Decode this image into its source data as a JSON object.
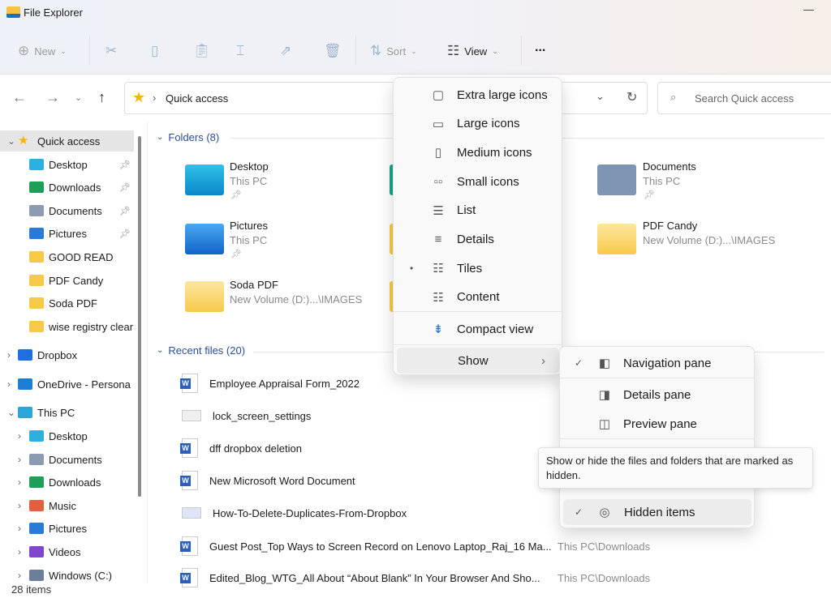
{
  "window": {
    "title": "File Explorer",
    "status": "28 items"
  },
  "toolbar": {
    "new": "New",
    "sort": "Sort",
    "view": "View",
    "more": "..."
  },
  "address": {
    "location": "Quick access",
    "search_placeholder": "Search Quick access"
  },
  "sidebar": {
    "items": [
      {
        "label": "Quick access",
        "icon": "star"
      },
      {
        "label": "Desktop",
        "icon": "desktop",
        "pinned": true
      },
      {
        "label": "Downloads",
        "icon": "download",
        "pinned": true
      },
      {
        "label": "Documents",
        "icon": "documents",
        "pinned": true
      },
      {
        "label": "Pictures",
        "icon": "pictures",
        "pinned": true
      },
      {
        "label": "GOOD READ",
        "icon": "folder"
      },
      {
        "label": "PDF Candy",
        "icon": "folder"
      },
      {
        "label": "Soda PDF",
        "icon": "folder"
      },
      {
        "label": "wise registry clear",
        "icon": "folder"
      },
      {
        "label": "Dropbox",
        "icon": "dropbox"
      },
      {
        "label": "OneDrive - Persona",
        "icon": "onedrive"
      },
      {
        "label": "This PC",
        "icon": "pc"
      },
      {
        "label": "Desktop",
        "icon": "desktop"
      },
      {
        "label": "Documents",
        "icon": "documents"
      },
      {
        "label": "Downloads",
        "icon": "download"
      },
      {
        "label": "Music",
        "icon": "music"
      },
      {
        "label": "Pictures",
        "icon": "pictures"
      },
      {
        "label": "Videos",
        "icon": "videos"
      },
      {
        "label": "Windows (C:)",
        "icon": "drive"
      }
    ]
  },
  "main": {
    "folders_header": "Folders (8)",
    "folders": [
      {
        "name": "Desktop",
        "location": "This PC",
        "pinned": true
      },
      {
        "name": "Documents",
        "location": "This PC",
        "pinned": true
      },
      {
        "name": "Pictures",
        "location": "This PC",
        "pinned": true
      },
      {
        "name": "PDF Candy",
        "location": "New Volume (D:)...\\IMAGES"
      },
      {
        "name": "Soda PDF",
        "location": "New Volume (D:)...\\IMAGES"
      }
    ],
    "recent_header": "Recent files (20)",
    "recent": [
      {
        "name": "Employee Appraisal Form_2022",
        "location": ""
      },
      {
        "name": "lock_screen_settings",
        "location": ""
      },
      {
        "name": "dff dropbox deletion",
        "location": ""
      },
      {
        "name": "New Microsoft Word Document",
        "location": ""
      },
      {
        "name": "How-To-Delete-Duplicates-From-Dropbox",
        "location": ""
      },
      {
        "name": "Guest Post_Top Ways to Screen Record on Lenovo Laptop_Raj_16 Ma...",
        "location": "This PC\\Downloads"
      },
      {
        "name": "Edited_Blog_WTG_All About “About Blank” In Your Browser And Sho...",
        "location": "This PC\\Downloads"
      }
    ]
  },
  "view_menu": {
    "items": [
      "Extra large icons",
      "Large icons",
      "Medium icons",
      "Small icons",
      "List",
      "Details",
      "Tiles",
      "Content"
    ],
    "selected": "Tiles",
    "compact": "Compact view",
    "show": "Show"
  },
  "show_menu": {
    "navigation_pane": "Navigation pane",
    "details_pane": "Details pane",
    "preview_pane": "Preview pane",
    "hidden_items": "Hidden items",
    "check": "✓"
  },
  "tooltip": "Show or hide the files and folders that are marked as hidden."
}
